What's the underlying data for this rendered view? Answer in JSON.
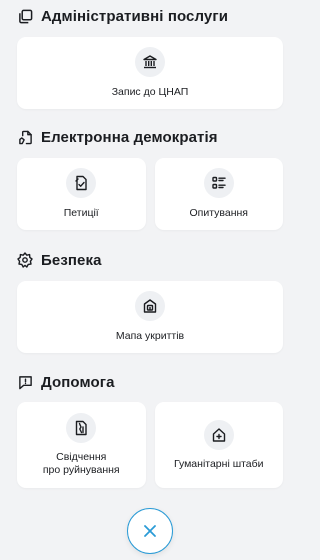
{
  "sections": [
    {
      "title": "Адміністративні послуги",
      "icon": "documents-icon",
      "cards": [
        {
          "label": "Запис до ЦНАП",
          "icon": "building-icon"
        }
      ]
    },
    {
      "title": "Електронна демократія",
      "icon": "document-hand-icon",
      "cards": [
        {
          "label": "Петиції",
          "icon": "petition-icon"
        },
        {
          "label": "Опитування",
          "icon": "survey-list-icon"
        }
      ]
    },
    {
      "title": "Безпека",
      "icon": "badge-icon",
      "cards": [
        {
          "label": "Мапа укриттів",
          "icon": "shelter-icon"
        }
      ]
    },
    {
      "title": "Допомога",
      "icon": "chat-alert-icon",
      "cards": [
        {
          "label": "Свідчення\nпро руйнування",
          "icon": "damage-report-icon"
        },
        {
          "label": "Гуманітарні штаби",
          "icon": "home-plus-icon"
        }
      ]
    }
  ],
  "close_button": {
    "icon": "close-icon"
  },
  "colors": {
    "background": "#f2f3f5",
    "card": "#ffffff",
    "accent": "#2a9bd6",
    "text": "#1b1d21"
  }
}
